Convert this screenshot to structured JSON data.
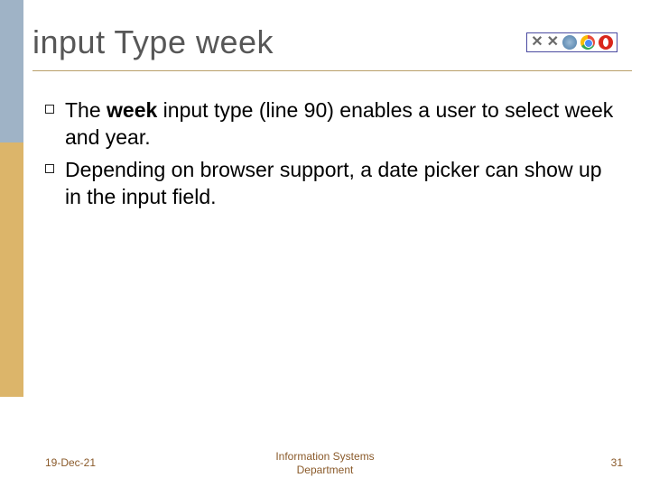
{
  "title": "input Type week",
  "browser_support": {
    "ie": "not-supported",
    "firefox": "not-supported",
    "safari_or_unknown": "supported",
    "chrome": "supported",
    "opera": "supported"
  },
  "bullets": [
    {
      "pre": "The ",
      "bold": "week",
      "post": " input type (line 90) enables a user to select week and year."
    },
    {
      "pre": "",
      "bold": "",
      "post": "Depending on browser support, a date picker can show up in the input field."
    }
  ],
  "footer": {
    "date": "19-Dec-21",
    "center_line1": "Information Systems",
    "center_line2": "Department",
    "page": "31"
  }
}
